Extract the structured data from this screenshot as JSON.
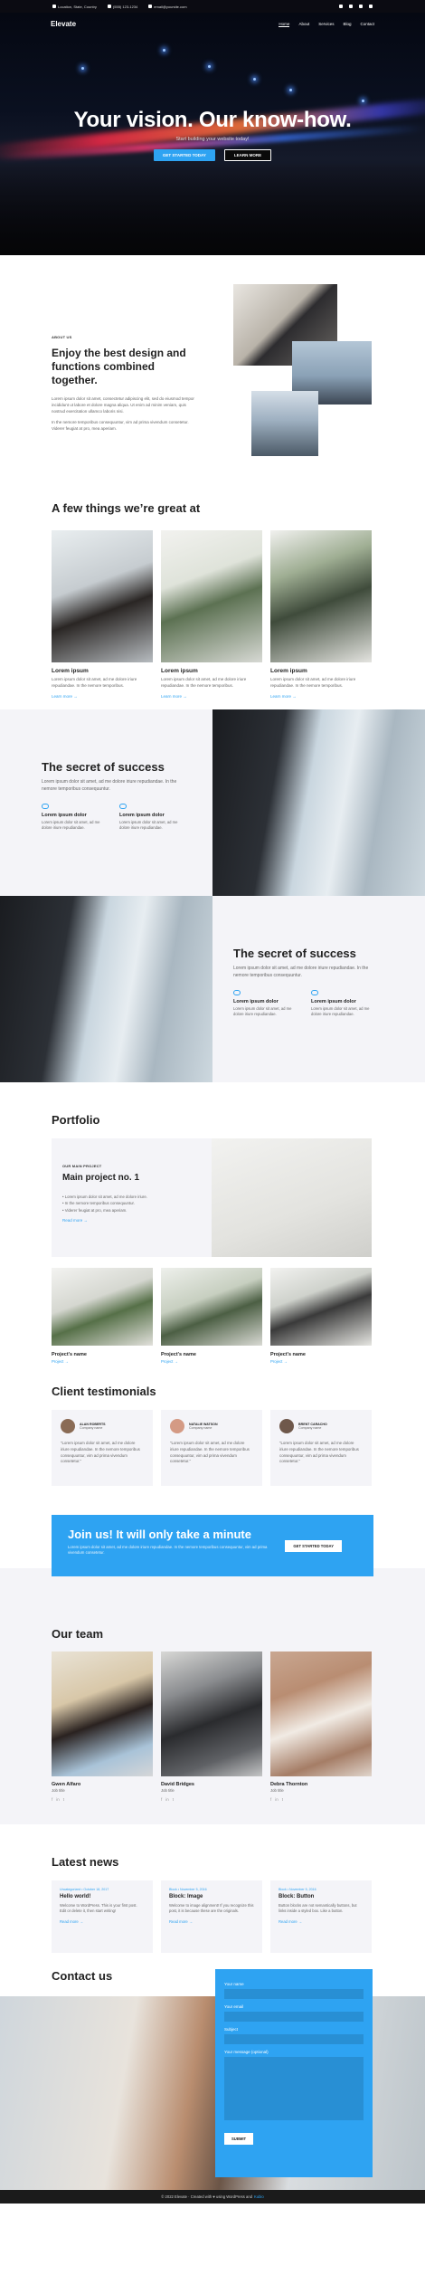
{
  "topbar": {
    "location": "Location, State, Country",
    "phone": "(555) 123-1234",
    "email": "email@yoursite.com"
  },
  "nav": {
    "logo": "Elevate",
    "items": [
      "Home",
      "About",
      "Services",
      "Blog",
      "Contact"
    ]
  },
  "hero": {
    "title": "Your vision. Our know-how.",
    "subtitle": "Start building your website today!",
    "primary_button": "GET STARTED TODAY",
    "secondary_button": "LEARN MORE"
  },
  "about": {
    "eyebrow": "ABOUT US",
    "title": "Enjoy the best design and functions combined together.",
    "p1": "Lorem ipsum dolor sit amet, consectetur adipiscing elit, sed do eiusmod tempor incididunt ut labore et dolore magna aliqua. Ut enim ad minim veniam, quis nostrud exercitation ullamco laboris nisi.",
    "p2": "In the nemore temporibus consequuntur, vim ad prima vivendum consetetur. Viderer feugiat at pro, mea aperiam."
  },
  "few": {
    "title": "A few things we’re great at",
    "cards": [
      {
        "title": "Lorem ipsum",
        "text": "Lorem ipsum dolor sit amet, ad me dolore iriure repudiandae. In the nemore temporibus.",
        "link": "Learn more"
      },
      {
        "title": "Lorem ipsum",
        "text": "Lorem ipsum dolor sit amet, ad me dolore iriure repudiandae. In the nemore temporibus.",
        "link": "Learn more"
      },
      {
        "title": "Lorem ipsum",
        "text": "Lorem ipsum dolor sit amet, ad me dolore iriure repudiandae. In the nemore temporibus.",
        "link": "Learn more"
      }
    ]
  },
  "secret1": {
    "title": "The secret of success",
    "text": "Lorem ipsum dolor sit amet, ad me dolore iriure repudiandae. In the nemore temporibus consequuntur.",
    "features": [
      {
        "title": "Lorem ipsum dolor",
        "text": "Lorem ipsum dolor sit amet, ad me dolore iriure repudiandae."
      },
      {
        "title": "Lorem ipsum dolor",
        "text": "Lorem ipsum dolor sit amet, ad me dolore iriure repudiandae."
      }
    ]
  },
  "secret2": {
    "title": "The secret of success",
    "text": "Lorem ipsum dolor sit amet, ad me dolore iriure repudiandae. In the nemore temporibus consequuntur.",
    "features": [
      {
        "title": "Lorem ipsum dolor",
        "text": "Lorem ipsum dolor sit amet, ad me dolore iriure repudiandae."
      },
      {
        "title": "Lorem ipsum dolor",
        "text": "Lorem ipsum dolor sit amet, ad me dolore iriure repudiandae."
      }
    ]
  },
  "portfolio": {
    "title": "Portfolio",
    "main": {
      "eyebrow": "OUR MAIN PROJECT",
      "title": "Main project no. 1",
      "bullets": [
        "Lorem ipsum dolor sit amet, ad me dolore iriure.",
        "In the nemore temporibus consequuntur.",
        "Viderer feugiat at pro, mea aperiam."
      ],
      "link": "Read more"
    },
    "projects": [
      {
        "name": "Project's name",
        "category": "Project"
      },
      {
        "name": "Project's name",
        "category": "Project"
      },
      {
        "name": "Project's name",
        "category": "Project"
      }
    ]
  },
  "testimonials": {
    "title": "Client testimonials",
    "items": [
      {
        "name": "ALAN ROBERTS",
        "company": "Company name",
        "quote": "“Lorem ipsum dolor sit amet, ad me dolore iriure repudiandae. In the nemore temporibus consequuntur, vim ad prima vivendum consetetur.”"
      },
      {
        "name": "NATALIE WATSON",
        "company": "Company name",
        "quote": "“Lorem ipsum dolor sit amet, ad me dolore iriure repudiandae. In the nemore temporibus consequuntur, vim ad prima vivendum consetetur.”"
      },
      {
        "name": "BRENT CARACHO",
        "company": "Company name",
        "quote": "“Lorem ipsum dolor sit amet, ad me dolore iriure repudiandae. In the nemore temporibus consequuntur, vim ad prima vivendum consetetur.”"
      }
    ]
  },
  "cta": {
    "title": "Join us! It will only take a minute",
    "text": "Lorem ipsum dolor sit amet, ad me dolore iriure repudiandae. In the nemore temporibus consequuntur, vim ad prima vivendum consetetur.",
    "button": "GET STARTED TODAY"
  },
  "team": {
    "title": "Our team",
    "members": [
      {
        "name": "Gwen Alfaro",
        "role": "Job title"
      },
      {
        "name": "David Bridges",
        "role": "Job title"
      },
      {
        "name": "Debra Thornton",
        "role": "Job title"
      }
    ]
  },
  "news": {
    "title": "Latest news",
    "items": [
      {
        "meta": "Uncategorized  •  October 18, 2017",
        "title": "Hello world!",
        "text": "Welcome to WordPress. This is your first post. Edit or delete it, then start writing!",
        "more": "Read more"
      },
      {
        "meta": "Block  •  November 5, 2016",
        "title": "Block: Image",
        "text": "Welcome to image alignment! If you recognize this post, it is because these are the originals.",
        "more": "Read more"
      },
      {
        "meta": "Block  •  November 5, 2016",
        "title": "Block: Button",
        "text": "Button blocks are not semantically buttons, but links inside a styled box. Like a button.",
        "more": "Read more"
      }
    ]
  },
  "contact": {
    "title": "Contact us",
    "form": {
      "name_label": "Your name",
      "email_label": "Your email",
      "subject_label": "Subject",
      "message_label": "Your message (optional)",
      "submit": "SUBMIT"
    }
  },
  "footer": {
    "text": "© 2022 Elevate · Created with ♥ using WordPress and",
    "link": "Kubio"
  },
  "colors": {
    "accent": "#2ea3f2",
    "light_bg": "#f4f4f8"
  }
}
